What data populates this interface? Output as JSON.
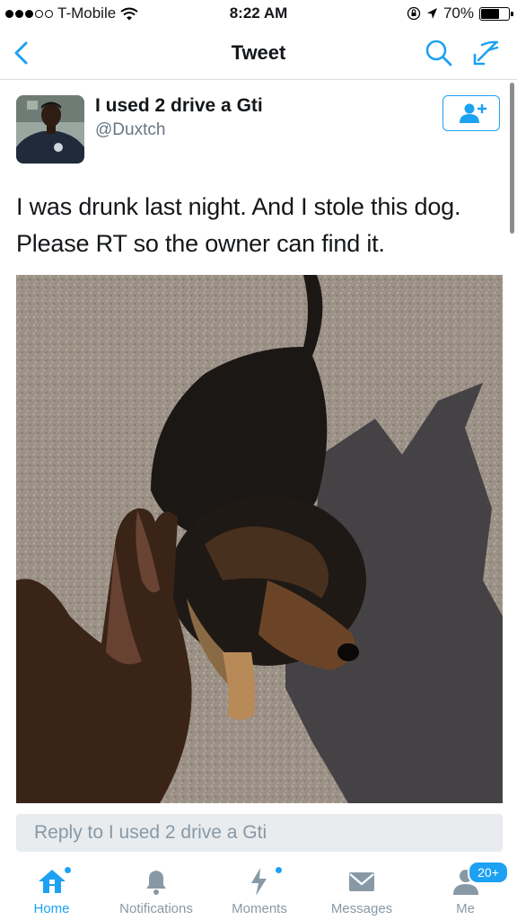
{
  "status_bar": {
    "carrier": "T-Mobile",
    "time": "8:22 AM",
    "battery": "70%",
    "battery_level": 0.7
  },
  "nav": {
    "title": "Tweet",
    "icons": [
      "back-chevron-icon",
      "search-icon",
      "compose-icon"
    ]
  },
  "tweet": {
    "display_name": "I used 2 drive a Gti",
    "handle": "@Duxtch",
    "text_line1": "I was drunk last night. And I stole this dog.",
    "text_line2": "Please RT so the owner can find it.",
    "follow_icon": "add-user-icon"
  },
  "reply": {
    "placeholder": "Reply to I used 2 drive a Gti"
  },
  "tabs": [
    {
      "label": "Home",
      "icon": "home-icon",
      "active": true
    },
    {
      "label": "Notifications",
      "icon": "bell-icon",
      "active": false
    },
    {
      "label": "Moments",
      "icon": "lightning-icon",
      "active": false
    },
    {
      "label": "Messages",
      "icon": "envelope-icon",
      "active": false
    },
    {
      "label": "Me",
      "icon": "person-icon",
      "active": false,
      "badge": "20+"
    }
  ],
  "colors": {
    "accent": "#1da1f2",
    "muted": "#8899a6",
    "text": "#14171a"
  }
}
